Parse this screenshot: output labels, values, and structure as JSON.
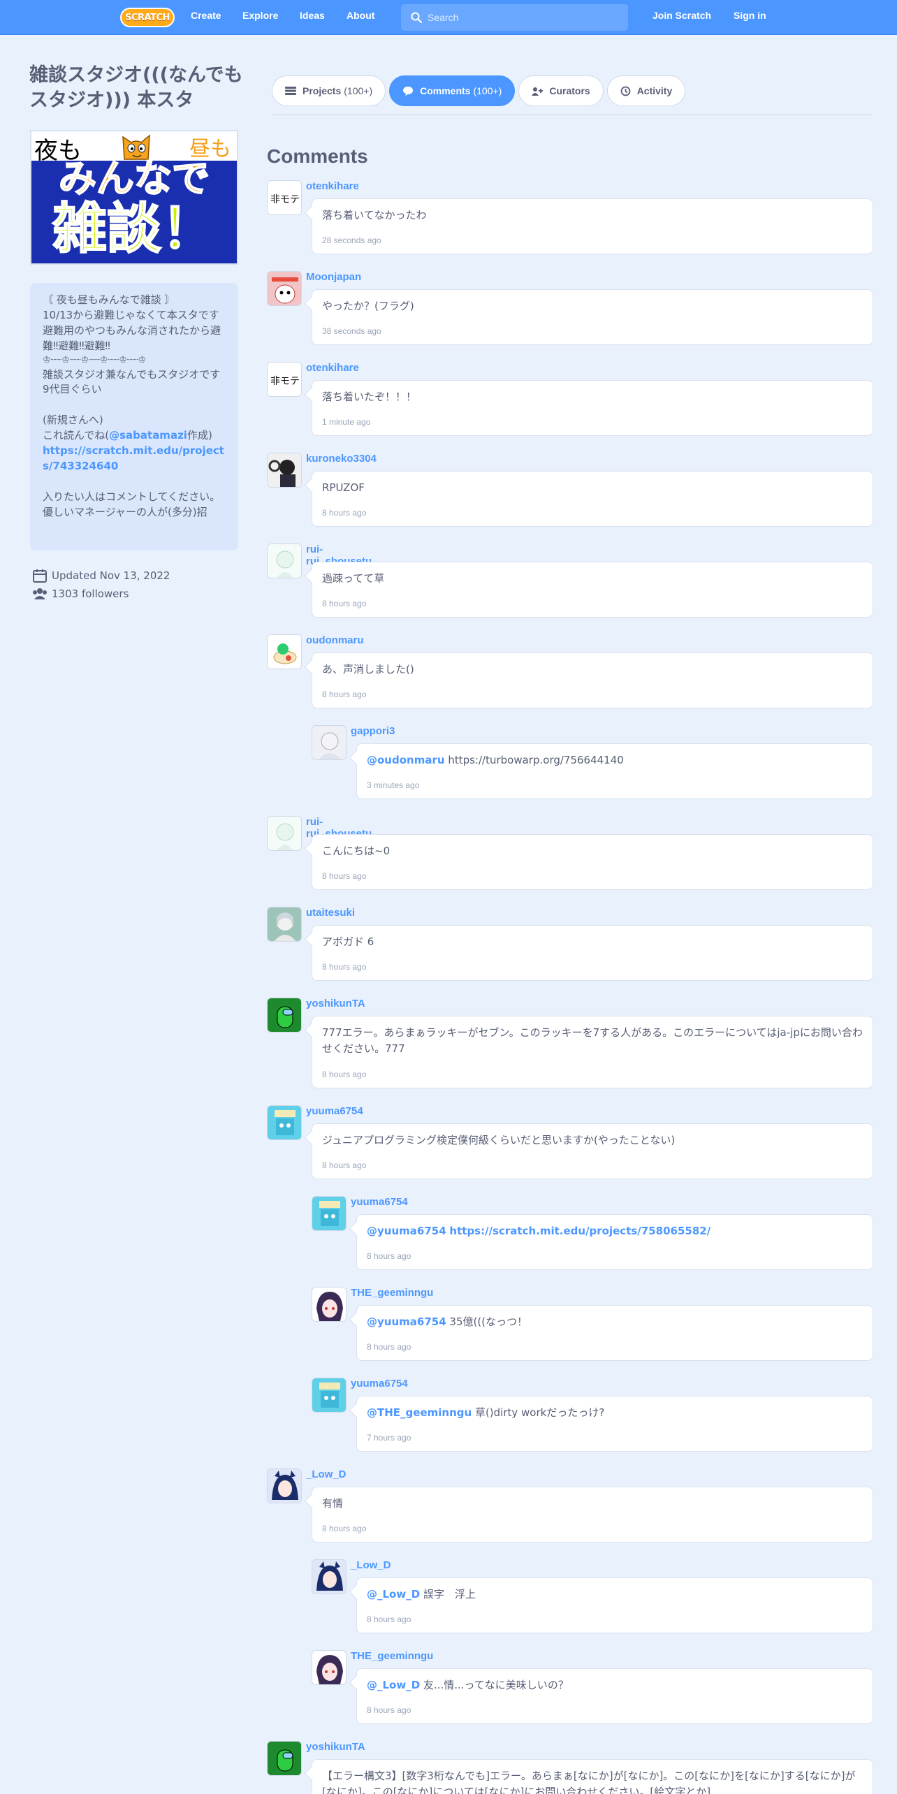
{
  "nav": {
    "logo_text": "SCRATCH",
    "links": [
      "Create",
      "Explore",
      "Ideas",
      "About"
    ],
    "search_placeholder": "Search",
    "join": "Join Scratch",
    "signin": "Sign in"
  },
  "studio": {
    "title": "雑談スタジオ(((なんでもスタジオ))) 本スタ",
    "thumbnail": {
      "top_left": "夜も",
      "top_right": "昼も",
      "middle": "みんなで",
      "bottom": "雑談！"
    },
    "description": {
      "l1": "〘 夜も昼もみんなで雑談 〙",
      "l2": "10/13から避難じゃなくて本スタです",
      "l3": "避難用のやつもみんな消されたから避難‼避難‼避難‼",
      "l4": "♔┈┈♔┈┈♔┈┈♔┈┈♔┈┈♔",
      "l5": "雑談スタジオ兼なんでもスタジオです",
      "l6": "9代目ぐらい",
      "l7": "(新規さんへ)",
      "l8_pre": "これ読んでね(",
      "l8_mention": "@sabatamazi",
      "l8_post": "作成)",
      "l9_link": "https://scratch.mit.edu/projects/743324640",
      "l10": "入りたい人はコメントしてください。",
      "l11": "優しいマネージャーの人が(多分)招"
    },
    "updated": "Updated Nov 13, 2022",
    "followers": "1303 followers"
  },
  "tabs": {
    "projects": {
      "label": "Projects",
      "count": "(100+)"
    },
    "comments": {
      "label": "Comments",
      "count": "(100+)"
    },
    "curators": {
      "label": "Curators"
    },
    "activity": {
      "label": "Activity"
    }
  },
  "comments_heading": "Comments",
  "comments": [
    {
      "user": "otenkihare",
      "text": "落ち着いてなかったわ",
      "time": "28 seconds ago",
      "avatar_text": "非モテ"
    },
    {
      "user": "Moonjapan",
      "text": "やったか？(フラグ)",
      "time": "38 seconds ago"
    },
    {
      "user": "otenkihare",
      "text": "落ち着いたぞ！！！",
      "time": "1 minute ago",
      "avatar_text": "非モテ"
    },
    {
      "user": "kuroneko3304",
      "text": "RPUZOF",
      "time": "8 hours ago"
    },
    {
      "user": "rui-rui_shousetu",
      "text": "過疎ってて草",
      "time": "8 hours ago"
    },
    {
      "user": "oudonmaru",
      "text": "あ、声消しました()",
      "time": "8 hours ago"
    },
    {
      "user": "gappori3",
      "mention": "@oudonmaru",
      "text": "https://turbowarp.org/756644140",
      "time": "3 minutes ago"
    },
    {
      "user": "rui-rui_shousetu",
      "text": "こんにちは~0",
      "time": "8 hours ago"
    },
    {
      "user": "utaitesuki",
      "text": "アボガド 6",
      "time": "8 hours ago"
    },
    {
      "user": "yoshikunTA",
      "text": "777エラー。あらまぁラッキーがセブン。このラッキーを7する人がある。このエラーについてはja-jpにお問い合わせください。777",
      "time": "8 hours ago"
    },
    {
      "user": "yuuma6754",
      "text": "ジュニアプログラミング検定僕何級くらいだと思いますか(やったことない)",
      "time": "8 hours ago"
    },
    {
      "user": "yuuma6754",
      "mention": "@yuuma6754",
      "link": "https://scratch.mit.edu/projects/758065582/",
      "time": "8 hours ago"
    },
    {
      "user": "THE_geeminngu",
      "mention": "@yuuma6754",
      "text": "35億(((なっつ！",
      "time": "8 hours ago"
    },
    {
      "user": "yuuma6754",
      "mention": "@THE_geeminngu",
      "text": "草()dirty workだったっけ?",
      "time": "7 hours ago"
    },
    {
      "user": "_Low_D",
      "text": "有情",
      "time": "8 hours ago"
    },
    {
      "user": "_Low_D",
      "mention": "@_Low_D",
      "text": "誤字　浮上",
      "time": "8 hours ago"
    },
    {
      "user": "THE_geeminngu",
      "mention": "@_Low_D",
      "text": "友...情...ってなに美味しいの？",
      "time": "8 hours ago"
    },
    {
      "user": "yoshikunTA",
      "text": "【エラー構文3】[数字3桁なんでも]エラー。あらまぁ[なにか]が[なにか]。この[なにか]を[なにか]する[なにか]が[なにか]。この[なにか]については[なにか]にお問い合わせください。[絵文字とか]",
      "time": ""
    }
  ]
}
